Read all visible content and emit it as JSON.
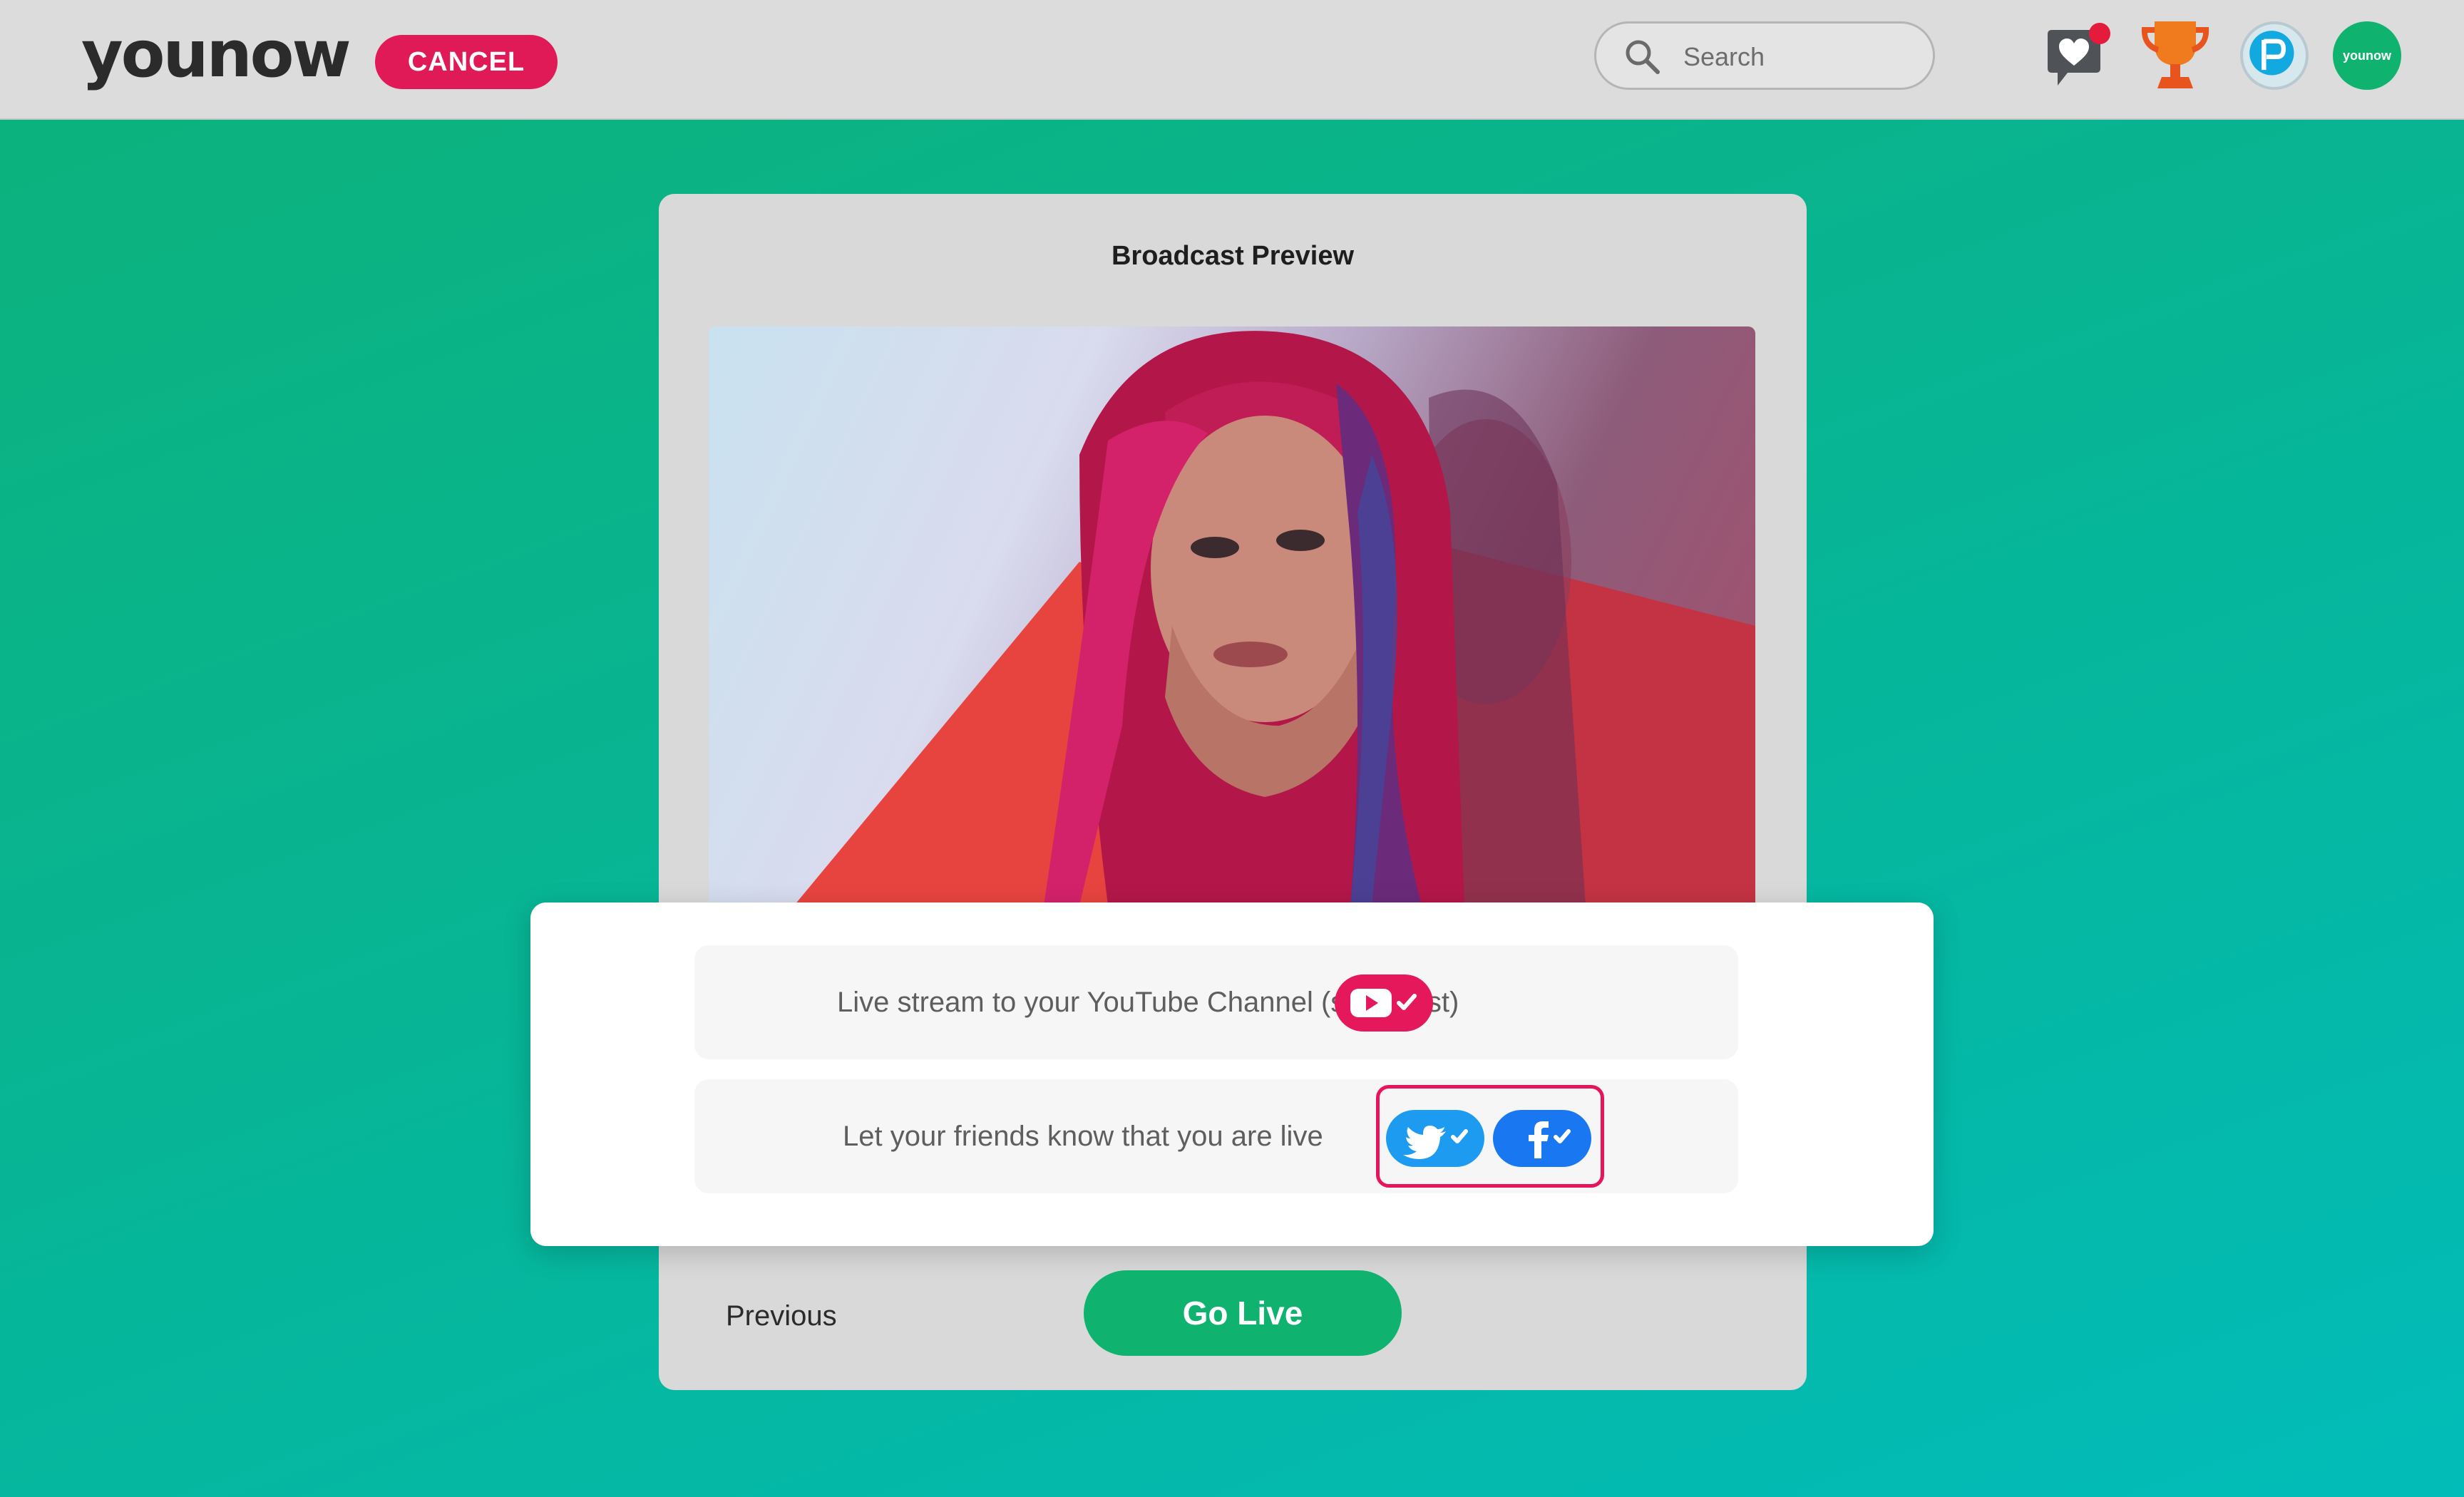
{
  "header": {
    "logo": "younow",
    "cancel_label": "CANCEL",
    "search_placeholder": "Search",
    "avatar_text": "younow"
  },
  "card": {
    "title": "Broadcast Preview"
  },
  "share_options": {
    "youtube_text": "Live stream to your YouTube Channel (simulcast)",
    "friends_text": "Let your friends know that you are live",
    "youtube_enabled": true,
    "twitter_enabled": true,
    "facebook_enabled": true
  },
  "actions": {
    "previous_label": "Previous",
    "go_live_label": "Go Live"
  },
  "colors": {
    "brand_green": "#0fb36f",
    "accent_pink": "#e01a57",
    "twitter_blue": "#1d9bf0",
    "facebook_blue": "#1a77f2"
  },
  "icons": [
    "search-icon",
    "messages-icon",
    "trophy-icon",
    "pearls-icon",
    "youtube-icon",
    "twitter-icon",
    "facebook-icon",
    "checkmark-icon"
  ]
}
